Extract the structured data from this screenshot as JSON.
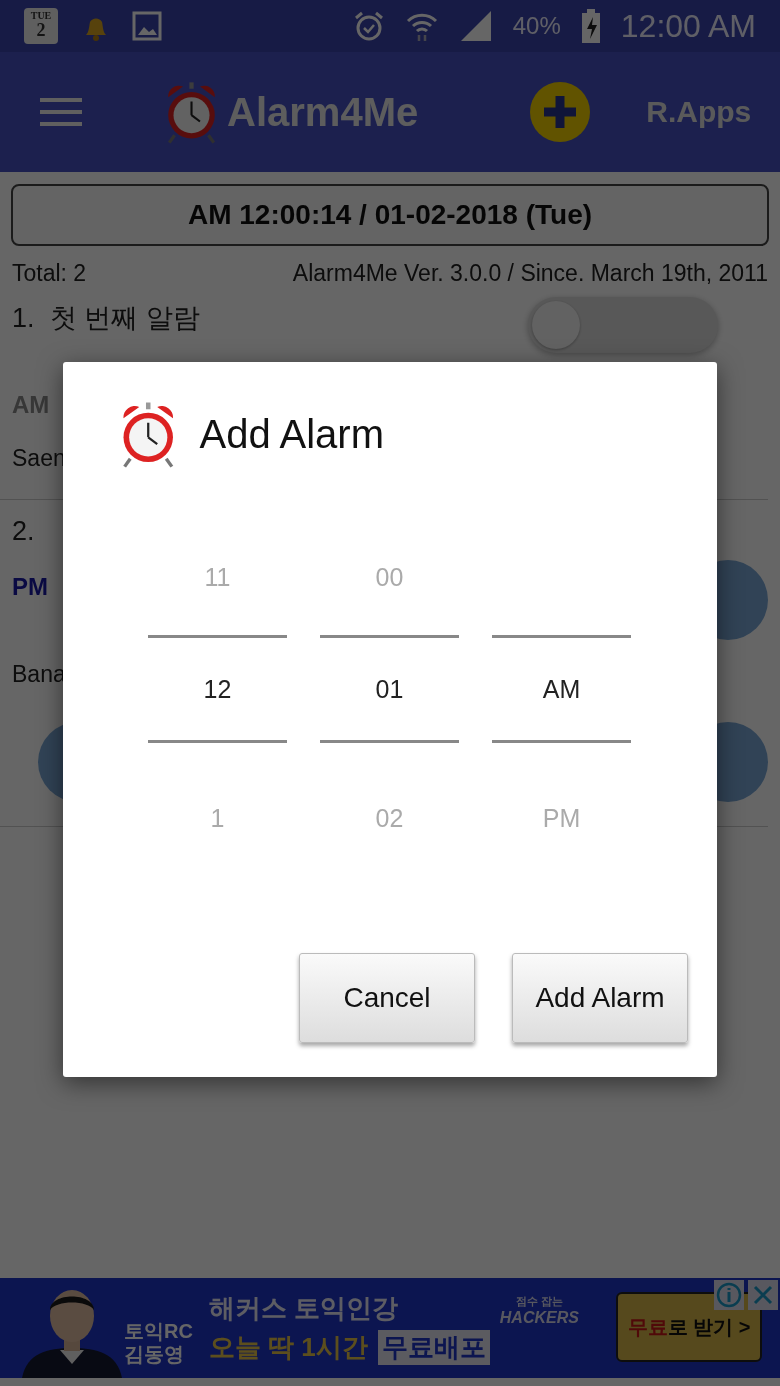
{
  "status_bar": {
    "calendar_day": "TUE",
    "calendar_date": "2",
    "battery": "40%",
    "time": "12:00 AM"
  },
  "app_bar": {
    "title": "Alarm4Me",
    "brand": "R.Apps"
  },
  "clock": "AM 12:00:14 / 01-02-2018 (Tue)",
  "total": "Total: 2",
  "version": "Alarm4Me Ver. 3.0.0 / Since. March 19th, 2011",
  "alarms": [
    {
      "number": "1.",
      "title": "첫 번째 알람",
      "on": false,
      "period": "AM",
      "period_active": false,
      "name": "Saen"
    },
    {
      "number": "2.",
      "period": "PM",
      "period_active": true,
      "name": "Bana"
    }
  ],
  "dialog": {
    "title": "Add Alarm",
    "columns": [
      {
        "above": "11",
        "selected": "12",
        "below": "1"
      },
      {
        "above": "00",
        "selected": "01",
        "below": "02"
      },
      {
        "selected": "AM",
        "below": "PM"
      }
    ],
    "buttons": [
      "Cancel",
      "Add Alarm"
    ]
  },
  "ad": {
    "caption_lines": [
      "토익RC",
      "김동영"
    ],
    "headline": "해커스 토익인강",
    "subline": "오늘 딱 1시간",
    "highlight": "무료배포",
    "logo_small": "점수 잡는",
    "logo": "HACKERS",
    "cta_accent": "무료",
    "cta_rest": "로 받기 >"
  }
}
